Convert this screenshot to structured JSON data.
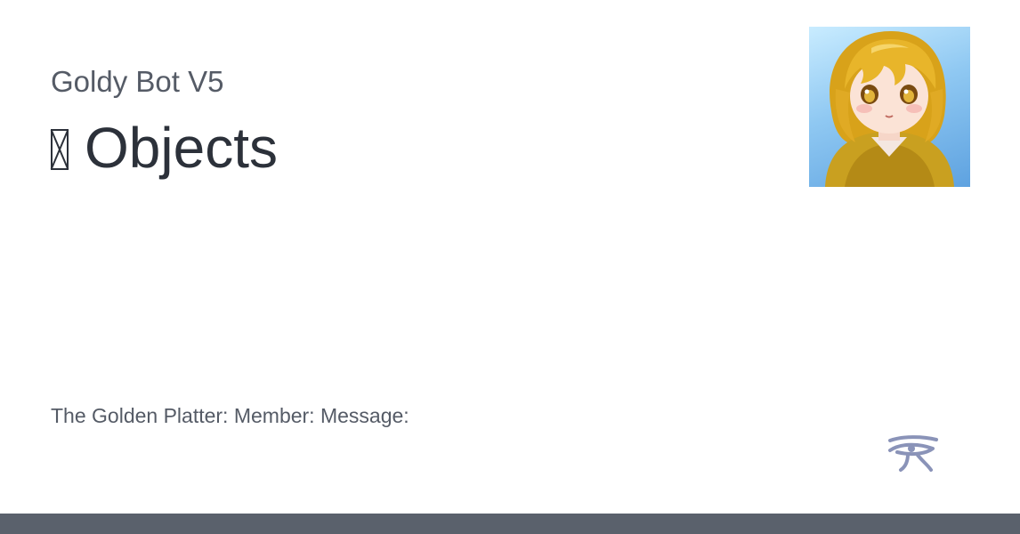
{
  "header": {
    "site_name": "Goldy Bot V5",
    "page_title": "Objects",
    "title_glyph_icon": "missing-glyph-icon"
  },
  "avatar": {
    "icon": "anime-girl-avatar"
  },
  "body": {
    "description": "The Golden Platter: Member: Message:"
  },
  "logo": {
    "icon": "eye-of-horus-icon",
    "color": "#8a93b8"
  },
  "footer": {
    "color": "#5a616c"
  }
}
